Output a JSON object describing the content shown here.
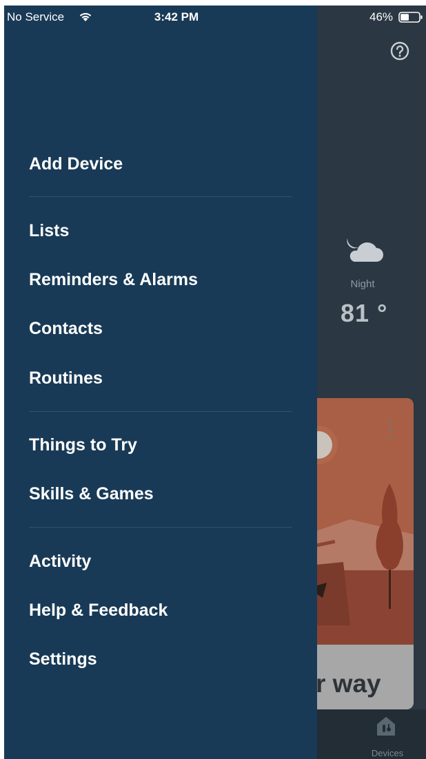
{
  "status_bar": {
    "carrier": "No Service",
    "time": "3:42 PM",
    "battery_percent": "46%",
    "battery_level": 0.46
  },
  "drawer": {
    "groups": [
      {
        "items": [
          {
            "label": "Add Device"
          }
        ]
      },
      {
        "items": [
          {
            "label": "Lists"
          },
          {
            "label": "Reminders & Alarms"
          },
          {
            "label": "Contacts"
          },
          {
            "label": "Routines"
          }
        ]
      },
      {
        "items": [
          {
            "label": "Things to Try"
          },
          {
            "label": "Skills & Games"
          }
        ]
      },
      {
        "items": [
          {
            "label": "Activity"
          },
          {
            "label": "Help & Feedback"
          },
          {
            "label": "Settings"
          }
        ]
      }
    ],
    "background_color": "#183a56"
  },
  "background_app": {
    "weather": {
      "period": "Night",
      "temperature": "81 °",
      "icon": "moon-cloud-icon"
    },
    "promo_card": {
      "text_fragment": "r way",
      "color": "#a95f45"
    },
    "tab_bar": {
      "devices_label": "Devices",
      "devices_icon": "devices-icon"
    },
    "help_icon": "help-icon"
  }
}
